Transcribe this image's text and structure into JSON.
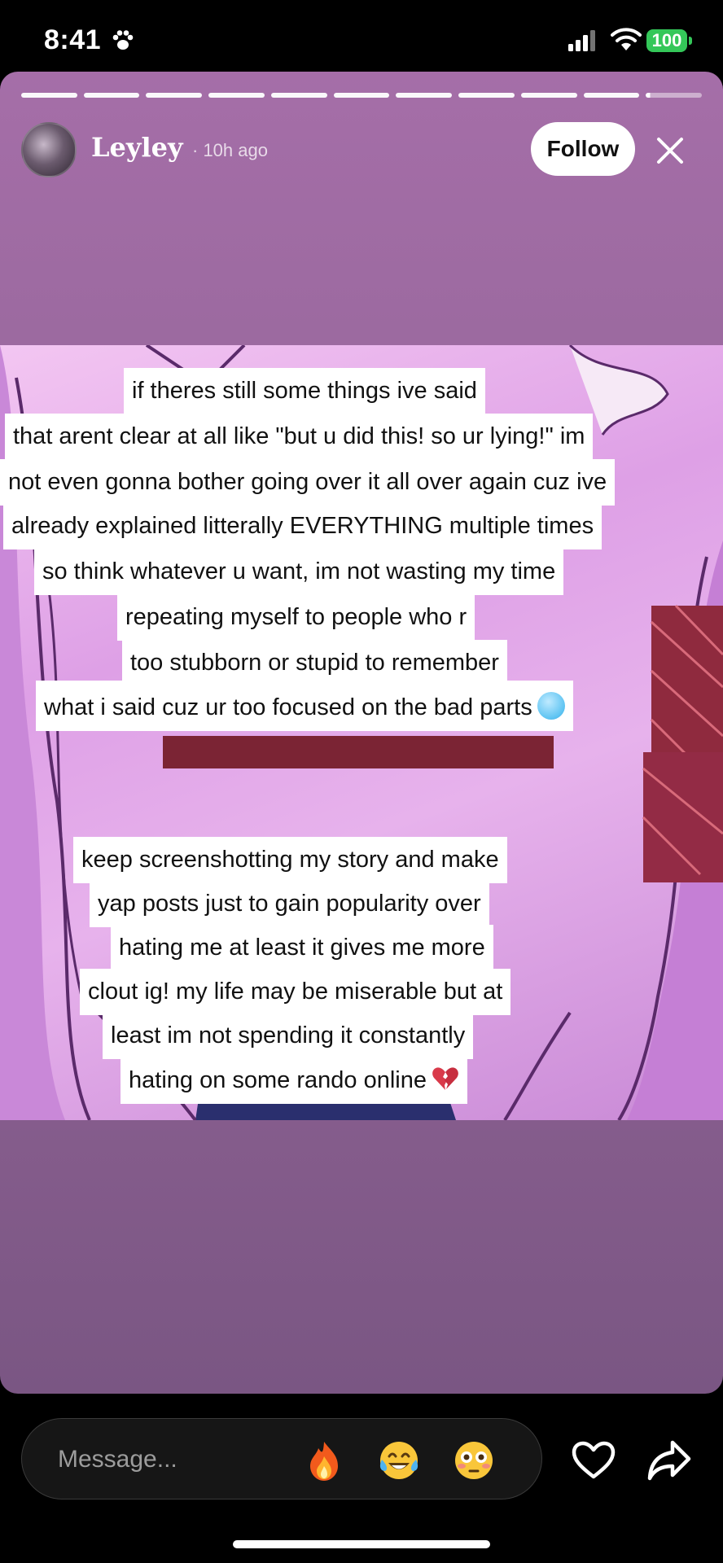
{
  "status_bar": {
    "time": "8:41",
    "battery": "100",
    "icons": [
      "paw-icon",
      "signal-icon",
      "wifi-icon",
      "battery-icon"
    ]
  },
  "story": {
    "progress": {
      "segments_total": 11,
      "segments_complete": 10,
      "current_segment_fraction": 0.08
    },
    "username": "Leyley",
    "time_ago": "· 10h ago",
    "follow_label": "Follow",
    "captions": [
      {
        "text": "if theres still some things ive said",
        "emoji": null
      },
      {
        "text": "that arent clear at all like \"but u did this! so ur lying!\" im",
        "emoji": null
      },
      {
        "text": "not even gonna bother going over it all over again cuz ive",
        "emoji": null
      },
      {
        "text": "already explained litterally EVERYTHING multiple times",
        "emoji": null
      },
      {
        "text": "so think whatever u want, im not wasting my time",
        "emoji": null
      },
      {
        "text": "repeating myself to people who r",
        "emoji": null
      },
      {
        "text": "too stubborn or stupid to remember",
        "emoji": null
      },
      {
        "text": "what i said cuz ur too focused on the bad parts",
        "emoji": "cold-face-emoji"
      },
      {
        "text": "keep screenshotting my story and make",
        "emoji": null
      },
      {
        "text": "yap posts just to gain popularity over",
        "emoji": null
      },
      {
        "text": "hating me at least it gives me more",
        "emoji": null
      },
      {
        "text": "clout ig! my life may be miserable but at",
        "emoji": null
      },
      {
        "text": "least im not spending it constantly",
        "emoji": null
      },
      {
        "text": "hating on some rando online",
        "emoji": "broken-heart-emoji"
      }
    ]
  },
  "bottom_bar": {
    "message_placeholder": "Message...",
    "quick_reactions": [
      "fire-emoji",
      "tears-of-joy-emoji",
      "flushed-face-emoji"
    ],
    "icons": [
      "heart-icon",
      "share-icon"
    ]
  },
  "colors": {
    "story_background": "#9c6aa0",
    "panel_pink": "#e7b2ec",
    "battery_green": "#34c759"
  }
}
